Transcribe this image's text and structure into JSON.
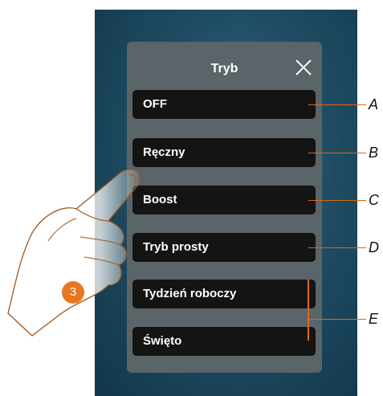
{
  "dialog": {
    "title": "Tryb",
    "close_icon": "close-icon"
  },
  "options": [
    {
      "label": "OFF",
      "callout": "A"
    },
    {
      "label": "Ręczny",
      "callout": "B"
    },
    {
      "label": "Boost",
      "callout": "C"
    },
    {
      "label": "Tryb prosty",
      "callout": "D"
    },
    {
      "label": "Tydzień roboczy",
      "callout": "E"
    },
    {
      "label": "Święto",
      "callout": "E"
    }
  ],
  "callouts": {
    "a": "A",
    "b": "B",
    "c": "C",
    "d": "D",
    "e": "E"
  },
  "step_badge": "3",
  "colors": {
    "accent": "#e87722",
    "panel": "#5b6468",
    "button": "#141414"
  }
}
